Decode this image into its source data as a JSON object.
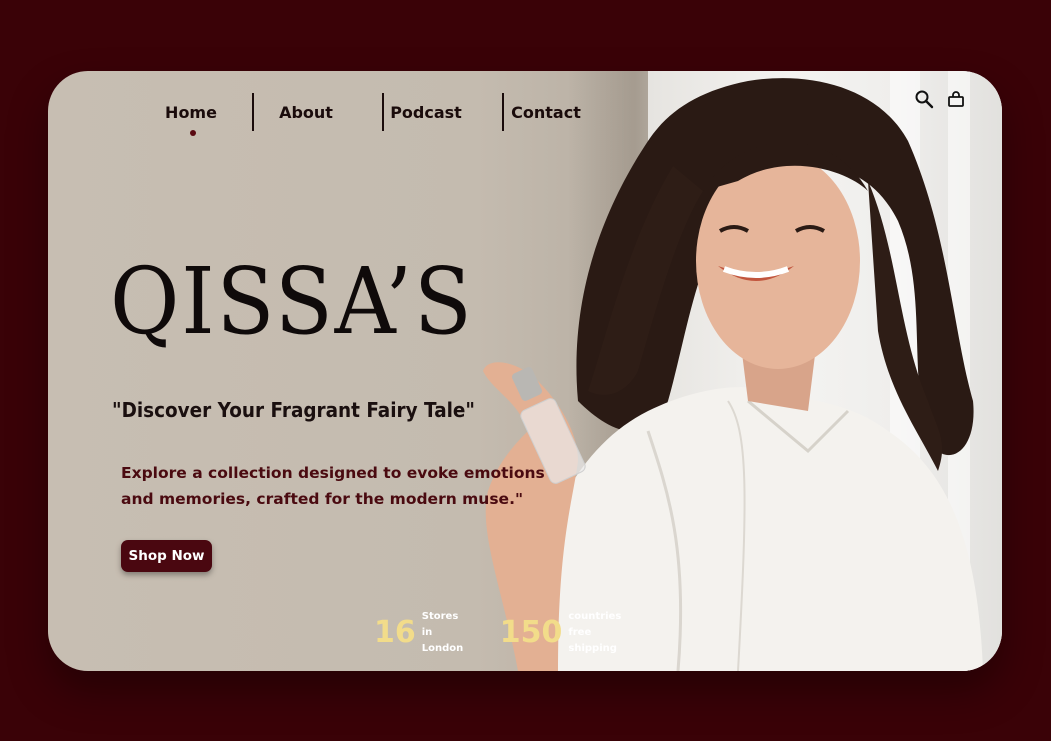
{
  "nav": {
    "items": [
      {
        "label": "Home",
        "active": true
      },
      {
        "label": "About",
        "active": false
      },
      {
        "label": "Podcast",
        "active": false
      },
      {
        "label": "Contact",
        "active": false
      }
    ],
    "icons": [
      "search-icon",
      "shopping-bag-icon"
    ]
  },
  "hero": {
    "brand": "QISSA’S",
    "tagline": "\"Discover Your Fragrant Fairy Tale\"",
    "description": "Explore a collection designed to evoke emotions and memories, crafted for the modern muse.\"",
    "cta_label": "Shop Now"
  },
  "stats": [
    {
      "number": "16",
      "label": "Stores in London"
    },
    {
      "number": "150",
      "label": "countries free shipping"
    }
  ],
  "colors": {
    "page_background": "#3a0207",
    "accent": "#4a0710",
    "stat_number": "#f2dc8a",
    "description_text": "#4a0a10"
  }
}
